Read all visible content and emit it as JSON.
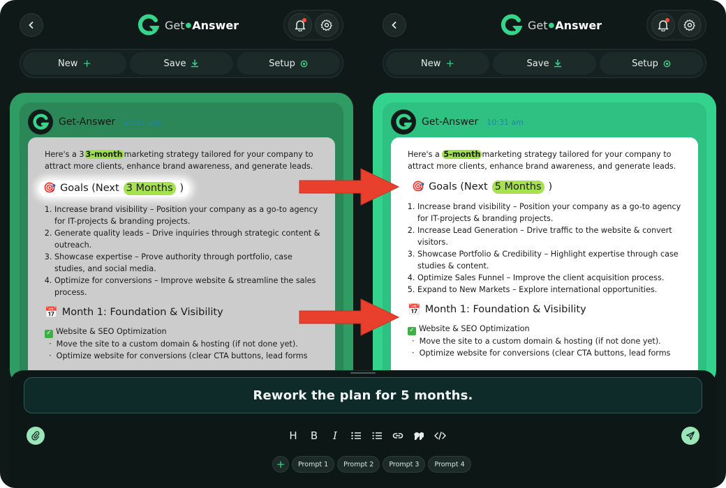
{
  "brand": {
    "get": "Get",
    "answer": "Answer"
  },
  "toolbar": {
    "new_label": "New",
    "save_label": "Save",
    "setup_label": "Setup"
  },
  "left": {
    "sender": "Get-Answer",
    "time": "10:31 am",
    "intro_pre": "Here's a 3",
    "intro_hl": "3-month",
    "intro_post": "marketing strategy tailored for your company to attract more clients, enhance brand awareness, and generate leads.",
    "goals_pre": "Goals (Next",
    "goals_hl": "3 Months",
    "goals_post": ")",
    "goals": [
      "Increase brand visibility – Position your company as a go-to agency for IT-projects & branding projects.",
      "Generate quality leads – Drive inquiries through strategic content & outreach.",
      "Showcase expertise – Prove authority through portfolio, case studies, and social media.",
      "Optimize for conversions – Improve website & streamline the sales process."
    ],
    "month_title": "Month 1: Foundation & Visibility",
    "section": "Website & SEO Optimization",
    "bullets": [
      "Move the site to a custom domain & hosting (if not done yet).",
      "Optimize website for conversions (clear CTA buttons, lead forms"
    ]
  },
  "right": {
    "sender": "Get-Answer",
    "time": "10:31 am",
    "intro_pre": "Here's a ",
    "intro_hl": "5-month",
    "intro_post": "marketing strategy tailored for your company to attract more clients, enhance brand awareness, and generate leads.",
    "goals_pre": "Goals (Next",
    "goals_hl": "5 Months",
    "goals_post": ")",
    "goals": [
      "Increase brand visibility – Position your company as a go-to agency for IT-projects & branding projects.",
      "Increase Lead Generation – Drive traffic to the website & convert visitors.",
      "Showcase Portfolio & Credibility – Highlight expertise through case studies & content.",
      "Optimize Sales Funnel – Improve the client acquisition process.",
      "Expand to New Markets – Explore international opportunities."
    ],
    "month_title": "Month 1: Foundation & Visibility",
    "section": "Website & SEO Optimization",
    "bullets": [
      "Move the site to a custom domain & hosting (if not done yet).",
      "Optimize website for conversions (clear CTA buttons, lead forms"
    ]
  },
  "composer": {
    "prompt_text": "Rework the plan for 5 months.",
    "format": {
      "heading": "H",
      "bold": "B",
      "italic": "I"
    },
    "chips": [
      "Prompt 1",
      "Prompt 2",
      "Prompt 3",
      "Prompt 4"
    ],
    "chip_add": "+"
  },
  "colors": {
    "background": "#0f1918",
    "accent": "#35d58b",
    "highlight": "#9fe04a",
    "arrow": "#e8402c",
    "left_card": "#2f9c64",
    "right_card": "#33d38d"
  },
  "icons": [
    "back-icon",
    "logo-icon",
    "bell-icon",
    "gear-icon",
    "plus-icon",
    "download-icon",
    "setup-icon",
    "target-icon",
    "calendar-icon",
    "check-icon",
    "paperclip-icon",
    "send-icon",
    "link-icon",
    "quote-icon",
    "code-icon",
    "list-icon"
  ]
}
